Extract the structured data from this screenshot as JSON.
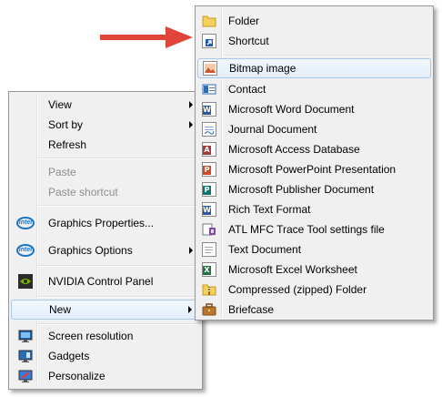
{
  "context_menu": {
    "view": "View",
    "sort_by": "Sort by",
    "refresh": "Refresh",
    "paste": "Paste",
    "paste_shortcut": "Paste shortcut",
    "graphics_properties": "Graphics Properties...",
    "graphics_options": "Graphics Options",
    "nvidia_control_panel": "NVIDIA Control Panel",
    "new": "New",
    "screen_resolution": "Screen resolution",
    "gadgets": "Gadgets",
    "personalize": "Personalize"
  },
  "new_submenu": {
    "folder": "Folder",
    "shortcut": "Shortcut",
    "bitmap_image": "Bitmap image",
    "contact": "Contact",
    "word_document": "Microsoft Word Document",
    "journal_document": "Journal Document",
    "access_database": "Microsoft Access Database",
    "powerpoint_presentation": "Microsoft PowerPoint Presentation",
    "publisher_document": "Microsoft Publisher Document",
    "rich_text_format": "Rich Text Format",
    "atl_mfc_trace": "ATL MFC Trace Tool settings file",
    "text_document": "Text Document",
    "excel_worksheet": "Microsoft Excel Worksheet",
    "compressed_folder": "Compressed (zipped) Folder",
    "briefcase": "Briefcase"
  },
  "icons": {
    "intel_logo_text": "intel"
  },
  "colors": {
    "annotation_arrow": "#e0453a",
    "highlight_border": "#a8c8ec",
    "disabled_text": "#8e8e8e"
  }
}
